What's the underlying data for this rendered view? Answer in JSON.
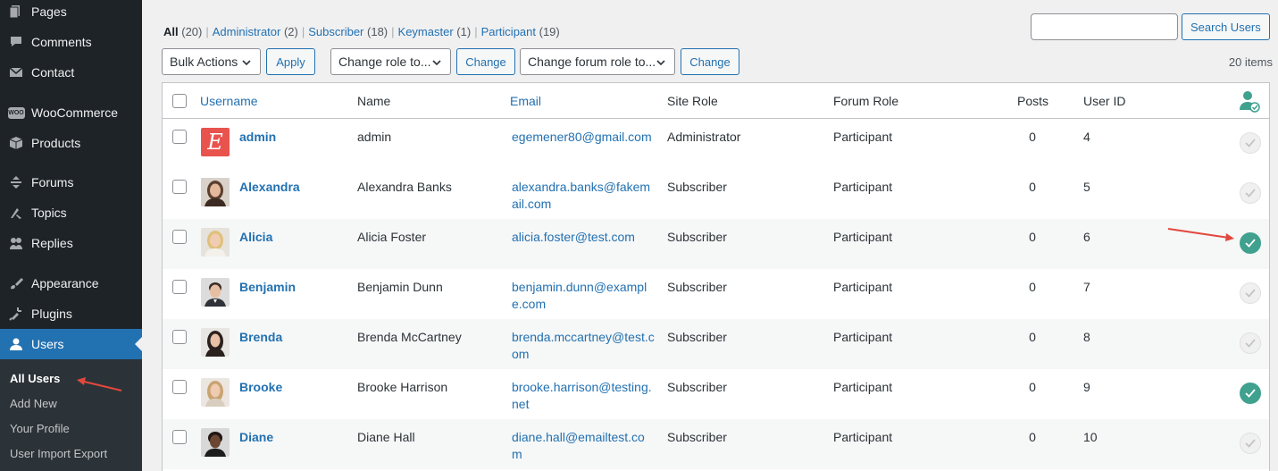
{
  "sidebar": {
    "items": [
      {
        "label": "Pages",
        "icon": "pages-icon"
      },
      {
        "label": "Comments",
        "icon": "comments-icon"
      },
      {
        "label": "Contact",
        "icon": "contact-icon"
      },
      {
        "label": "WooCommerce",
        "icon": "woocommerce-icon",
        "badge": "WOO"
      },
      {
        "label": "Products",
        "icon": "products-icon"
      },
      {
        "label": "Forums",
        "icon": "forums-icon"
      },
      {
        "label": "Topics",
        "icon": "topics-icon"
      },
      {
        "label": "Replies",
        "icon": "replies-icon"
      },
      {
        "label": "Appearance",
        "icon": "appearance-icon"
      },
      {
        "label": "Plugins",
        "icon": "plugins-icon"
      },
      {
        "label": "Users",
        "icon": "users-icon"
      }
    ],
    "submenu": [
      "All Users",
      "Add New",
      "Your Profile",
      "User Import Export"
    ]
  },
  "filters": [
    {
      "label": "All",
      "count": "(20)"
    },
    {
      "label": "Administrator",
      "count": "(2)"
    },
    {
      "label": "Subscriber",
      "count": "(18)"
    },
    {
      "label": "Keymaster",
      "count": "(1)"
    },
    {
      "label": "Participant",
      "count": "(19)"
    }
  ],
  "search": {
    "value": "",
    "button": "Search Users"
  },
  "actions": {
    "bulk": "Bulk Actions",
    "apply": "Apply",
    "change_role": "Change role to...",
    "change": "Change",
    "change_forum_role": "Change forum role to...",
    "change2": "Change",
    "items_count": "20 items"
  },
  "columns": {
    "username": "Username",
    "name": "Name",
    "email": "Email",
    "site_role": "Site Role",
    "forum_role": "Forum Role",
    "posts": "Posts",
    "user_id": "User ID"
  },
  "users": [
    {
      "username": "admin",
      "name": "admin",
      "email": "egemener80@gmail.com",
      "site_role": "Administrator",
      "forum_role": "Participant",
      "posts": "0",
      "id": "4",
      "verified": false,
      "avatar": "letter-e"
    },
    {
      "username": "Alexandra",
      "name": "Alexandra Banks",
      "email": "alexandra.banks@fakemail.com",
      "site_role": "Subscriber",
      "forum_role": "Participant",
      "posts": "0",
      "id": "5",
      "verified": false,
      "avatar": "photo"
    },
    {
      "username": "Alicia",
      "name": "Alicia Foster",
      "email": "alicia.foster@test.com",
      "site_role": "Subscriber",
      "forum_role": "Participant",
      "posts": "0",
      "id": "6",
      "verified": true,
      "avatar": "photo"
    },
    {
      "username": "Benjamin",
      "name": "Benjamin Dunn",
      "email": "benjamin.dunn@example.com",
      "site_role": "Subscriber",
      "forum_role": "Participant",
      "posts": "0",
      "id": "7",
      "verified": false,
      "avatar": "photo"
    },
    {
      "username": "Brenda",
      "name": "Brenda McCartney",
      "email": "brenda.mccartney@test.com",
      "site_role": "Subscriber",
      "forum_role": "Participant",
      "posts": "0",
      "id": "8",
      "verified": false,
      "avatar": "photo"
    },
    {
      "username": "Brooke",
      "name": "Brooke Harrison",
      "email": "brooke.harrison@testing.net",
      "site_role": "Subscriber",
      "forum_role": "Participant",
      "posts": "0",
      "id": "9",
      "verified": true,
      "avatar": "photo"
    },
    {
      "username": "Diane",
      "name": "Diane Hall",
      "email": "diane.hall@emailtest.com",
      "site_role": "Subscriber",
      "forum_role": "Participant",
      "posts": "0",
      "id": "10",
      "verified": false,
      "avatar": "photo"
    }
  ],
  "colors": {
    "accent": "#2271b1",
    "sidebar": "#1d2327",
    "verified": "#3fa18e",
    "arrow": "#e2483d"
  }
}
